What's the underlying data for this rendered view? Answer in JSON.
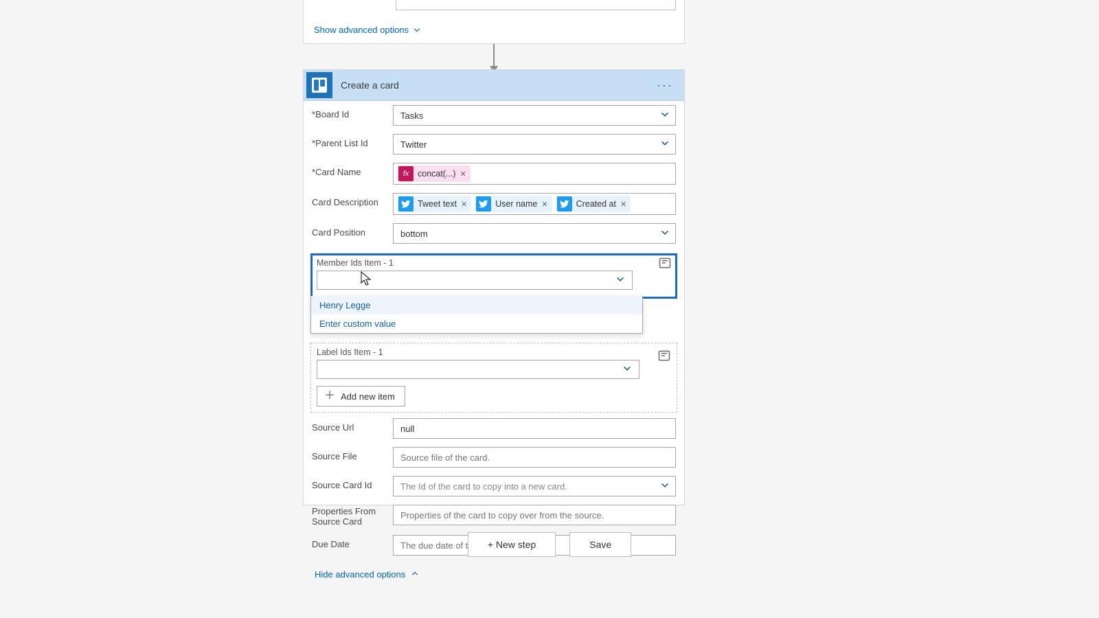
{
  "stepA": {
    "advanced_toggle": "Show advanced options"
  },
  "stepB": {
    "title": "Create a card",
    "fields": {
      "board": {
        "label": "Board Id",
        "value": "Tasks"
      },
      "parent_list": {
        "label": "Parent List Id",
        "value": "Twitter"
      },
      "card_name": {
        "label": "Card Name",
        "fx_label": "concat(...)"
      },
      "description": {
        "label": "Card Description",
        "tokens": [
          {
            "ico": "tw",
            "label": "Tweet text"
          },
          {
            "ico": "tw",
            "label": "User name"
          },
          {
            "ico": "tw",
            "label": "Created at"
          }
        ]
      },
      "position": {
        "label": "Card Position",
        "value": "bottom"
      },
      "member_ids": {
        "label": "Member Ids Item - 1"
      },
      "label_ids": {
        "label": "Label Ids Item - 1"
      },
      "add_item": {
        "label": "Add new item"
      },
      "source_url": {
        "label": "Source Url",
        "value": "null"
      },
      "source_file": {
        "label": "Source File",
        "placeholder": "Source file of the card."
      },
      "source_card": {
        "label": "Source Card Id",
        "placeholder": "The Id of the card to copy into a new card."
      },
      "props_src": {
        "label": "Properties From Source Card",
        "placeholder": "Properties of the card to copy over from the source."
      },
      "due_date": {
        "label": "Due Date",
        "placeholder": "The due date of the card."
      }
    },
    "dropdown_options": [
      "Henry Legge",
      "Enter custom value"
    ],
    "bottom_toggle": "Hide advanced options"
  },
  "footer": {
    "new_step": "+ New step",
    "save": "Save"
  }
}
